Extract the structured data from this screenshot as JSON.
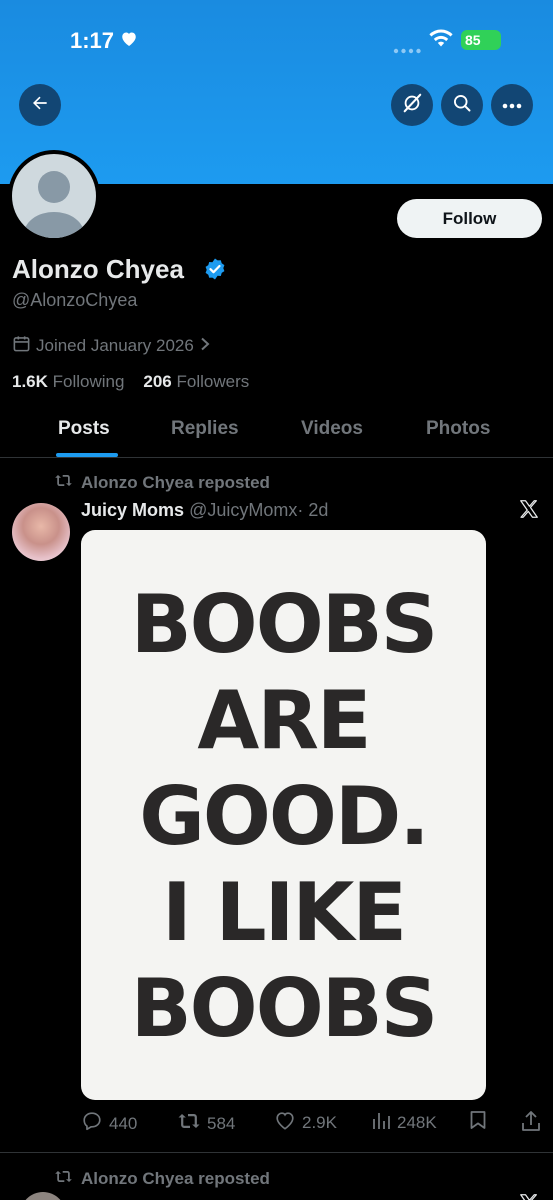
{
  "status_bar": {
    "time": "1:17",
    "battery": "85"
  },
  "profile": {
    "display_name": "Alonzo Chyea",
    "handle": "@AlonzoChyea",
    "joined": "Joined January 2026",
    "following_count": "1.6K",
    "following_label": "Following",
    "followers_count": "206",
    "followers_label": "Followers",
    "follow_button": "Follow"
  },
  "tabs": [
    "Posts",
    "Replies",
    "Videos",
    "Photos"
  ],
  "posts": [
    {
      "repost_label": "Alonzo Chyea reposted",
      "author_name": "Juicy Moms",
      "author_handle": "@JuicyMomx",
      "time": "· 2d",
      "image_text": [
        "BOOBS",
        "ARE",
        "GOOD.",
        "I LIKE",
        "BOOBS"
      ],
      "replies": "440",
      "reposts": "584",
      "likes": "2.9K",
      "views": "248K"
    },
    {
      "repost_label": "Alonzo Chyea reposted"
    }
  ],
  "icons": {
    "back": "arrow-left-icon",
    "grok": "grok-icon",
    "search": "search-icon",
    "more": "more-icon",
    "verified": "verified-badge-icon",
    "calendar": "calendar-icon",
    "repost": "repost-icon",
    "x_logo": "x-logo-icon"
  },
  "colors": {
    "accent": "#1d9bf0",
    "background": "#000000",
    "secondary_text": "#71767b",
    "battery": "#30d158"
  }
}
